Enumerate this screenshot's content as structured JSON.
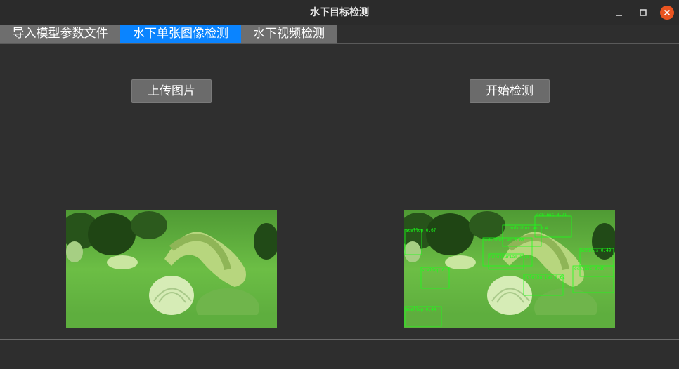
{
  "window": {
    "title": "水下目标检测",
    "controls": [
      "minimize-icon",
      "maximize-icon",
      "close-icon"
    ]
  },
  "tabs": [
    {
      "label": "导入模型参数文件",
      "active": false
    },
    {
      "label": "水下单张图像检测",
      "active": true
    },
    {
      "label": "水下视频检测",
      "active": false
    }
  ],
  "main": {
    "upload_label": "上传图片",
    "start_label": "开始检测"
  },
  "detections": [
    {
      "label": "scallop 0.67"
    },
    {
      "label": "echinus 0.71"
    },
    {
      "label": "holothurian 0.88"
    },
    {
      "label": "echinus 0.49"
    },
    {
      "label": "holothurian 0.35"
    },
    {
      "label": "holothurian 0.4"
    },
    {
      "label": "scallop 0.5"
    },
    {
      "label": "holothurian 0.62"
    },
    {
      "label": "scallop 0.44"
    },
    {
      "label": "echinus 0.39"
    }
  ],
  "colors": {
    "active_tab": "#0a84ff",
    "tab": "#6e6e6e",
    "button": "#6b6b6b",
    "close_button": "#e95420",
    "detection_box": "#19ff19"
  }
}
